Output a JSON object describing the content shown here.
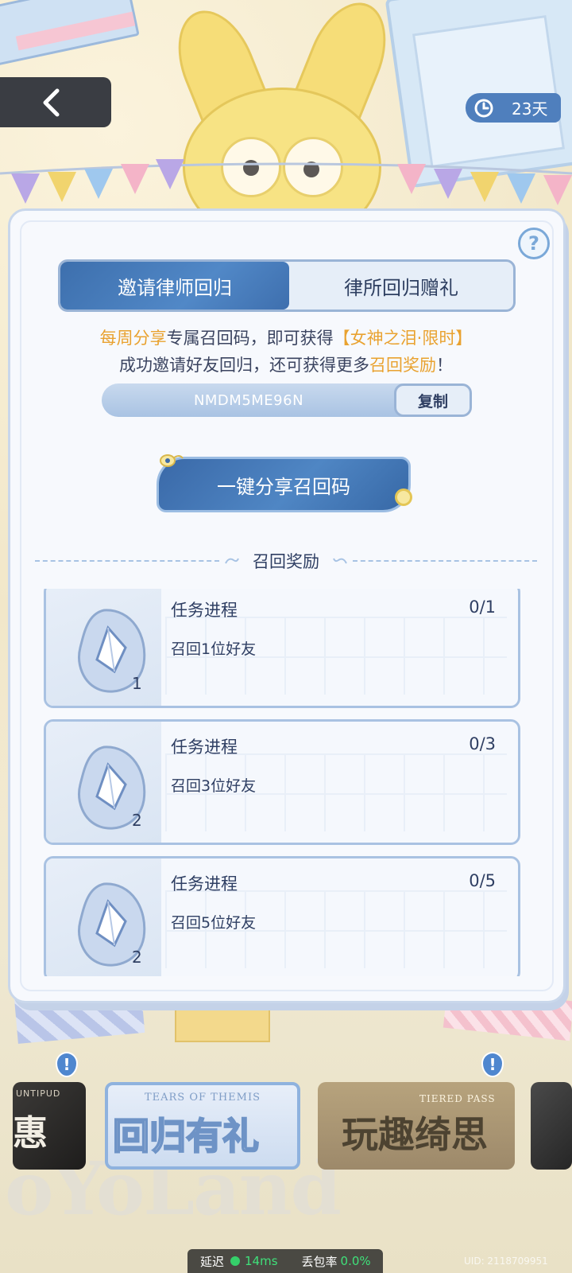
{
  "top": {
    "days_remaining": "23天"
  },
  "panel": {
    "help_label": "?",
    "tabs": [
      {
        "label": "邀请律师回归",
        "active": true
      },
      {
        "label": "律所回归赠礼",
        "active": false
      }
    ],
    "intro": {
      "line1_part1": "每周分享",
      "line1_part2": "专属召回码，即可获得",
      "line1_part3": "【女神之泪·限时】",
      "line2_part1": "成功邀请好友回归，还可获得更多",
      "line2_part2": "召回奖励",
      "line2_part3": "！"
    },
    "recall_code": "NMDM5ME96N",
    "copy_label": "复制",
    "share_label": "一键分享召回码",
    "section_title": "召回奖励",
    "tasks": [
      {
        "title": "任务进程",
        "progress": "0/1",
        "desc": "召回1位好友",
        "reward_count": "1"
      },
      {
        "title": "任务进程",
        "progress": "0/3",
        "desc": "召回3位好友",
        "reward_count": "2"
      },
      {
        "title": "任务进程",
        "progress": "0/5",
        "desc": "召回5位好友",
        "reward_count": "2"
      }
    ]
  },
  "banners": [
    {
      "sub": "UNTIPUD",
      "title": "惠",
      "alert": "!"
    },
    {
      "sub": "TEARS OF THEMIS",
      "title": "回归有礼"
    },
    {
      "sub": "TIERED PASS",
      "title": "玩趣绮思",
      "alert": "!"
    }
  ],
  "background": {
    "watermark": "oYoLand"
  },
  "status_bar": {
    "latency_label": "延迟",
    "latency_value": "14ms",
    "loss_label": "丢包率",
    "loss_value": "0.0%",
    "uid": "UID: 2118709951"
  },
  "colors": {
    "accent_blue": "#4f86c4",
    "highlight_orange": "#e9a230",
    "panel_bg": "#f7f9fd"
  }
}
